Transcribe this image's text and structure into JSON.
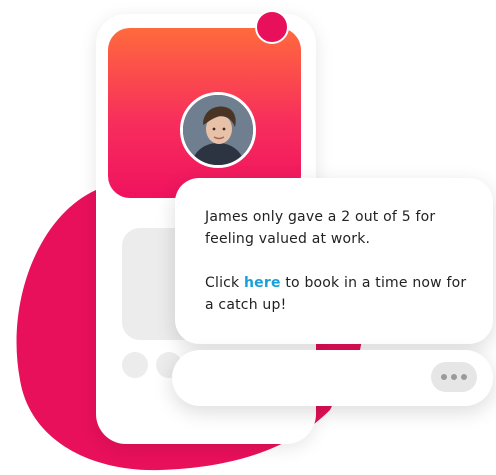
{
  "colors": {
    "accent": "#e8105a",
    "header_gradient_top": "#ff6a3d",
    "header_gradient_bottom": "#f0125f",
    "link": "#1aa0d8",
    "placeholder": "#ececec"
  },
  "message": {
    "line1": "James only gave a 2 out of 5 for feeling valued at work.",
    "line2_before": "Click ",
    "link_text": "here",
    "line2_after": " to book in a time now for a catch up!"
  },
  "icons": {
    "avatar": "profile-photo",
    "notification": "notification-dot",
    "typing": "typing-indicator-dots"
  }
}
